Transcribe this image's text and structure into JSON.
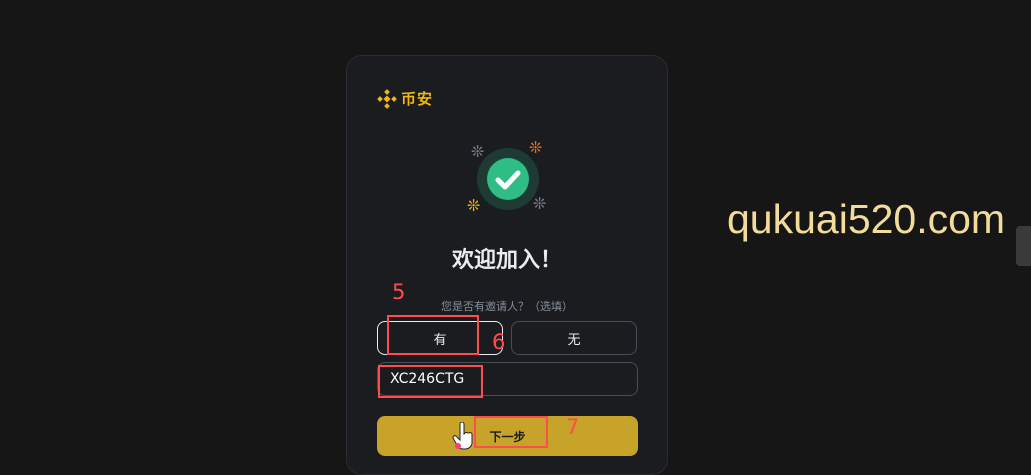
{
  "brand": {
    "name": "币安",
    "logo_icon": "binance-logo-icon",
    "color": "#f0b90b"
  },
  "welcome": {
    "title": "欢迎加入！",
    "success_icon": "check-circle-icon"
  },
  "referral": {
    "question": "您是否有邀请人？（选填）",
    "yes_label": "有",
    "no_label": "无",
    "code_value": "XC246CTG"
  },
  "next_button": {
    "label": "下一步"
  },
  "annotations": {
    "step5": "5",
    "step6": "6",
    "step7": "7",
    "color": "#ff4d4f"
  },
  "watermark": "qukuai520.com"
}
